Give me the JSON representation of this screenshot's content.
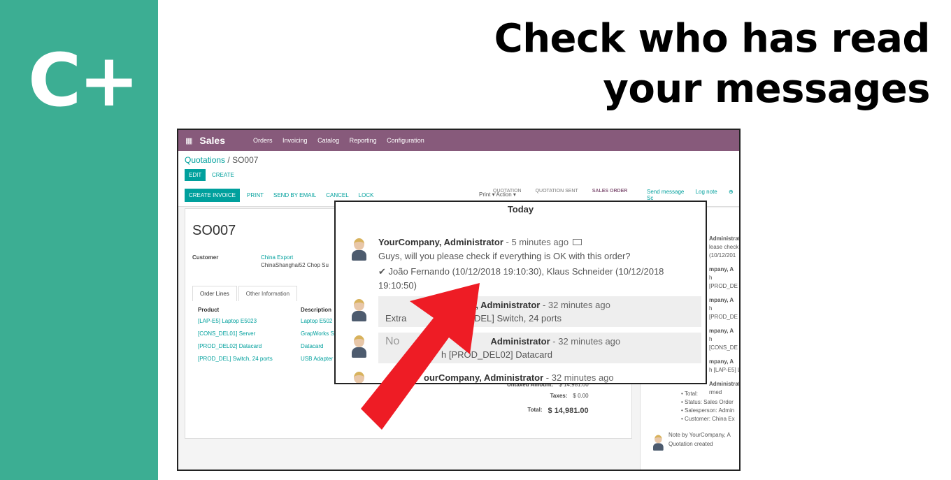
{
  "brand": {
    "logo_text": "C+",
    "side_color": "#3cae93"
  },
  "headline": {
    "line1": "Check who has read",
    "line2": "your messages"
  },
  "app": {
    "name": "Sales",
    "menu": [
      "Orders",
      "Invoicing",
      "Catalog",
      "Reporting",
      "Configuration"
    ],
    "bar_color": "#875a7b"
  },
  "breadcrumb": {
    "parent": "Quotations",
    "sep": " / ",
    "current": "SO007"
  },
  "buttons": {
    "edit": "EDIT",
    "create": "CREATE",
    "print": "Print ▾",
    "action": "Action ▾"
  },
  "actions": [
    "CREATE INVOICE",
    "PRINT",
    "SEND BY EMAIL",
    "CANCEL",
    "LOCK"
  ],
  "status_steps": [
    {
      "label": "QUOTATION",
      "active": false
    },
    {
      "label": "QUOTATION SENT",
      "active": false
    },
    {
      "label": "SALES ORDER",
      "active": true
    }
  ],
  "chatter_tabs": [
    "Send message",
    "Log note",
    "⊕ Sc"
  ],
  "form": {
    "name": "SO007",
    "customer_label": "Customer",
    "customer_value": "China Export",
    "customer_address": "ChinaShanghai52 Chop Su",
    "tabs": [
      "Order Lines",
      "Other Information"
    ],
    "columns": [
      "Product",
      "Description"
    ],
    "lines": [
      {
        "product": "[LAP-E5] Laptop E5023",
        "description": "Laptop E502"
      },
      {
        "product": "[CONS_DEL01] Server",
        "description": "GrapWorks S"
      },
      {
        "product": "[PROD_DEL02] Datacard",
        "description": "Datacard"
      },
      {
        "product": "[PROD_DEL] Switch, 24 ports",
        "description": "USB Adapter"
      }
    ],
    "totals": {
      "untaxed_label": "Untaxed Amount:",
      "untaxed_value": "$ 14,981.00",
      "taxes_label": "Taxes:",
      "taxes_value": "$ 0.00",
      "total_label": "Total:",
      "total_value": "$ 14,981.00"
    }
  },
  "chatter_side": {
    "items": [
      "Administrat",
      "lease check",
      "(10/12/201",
      "mpany, A",
      "h [PROD_DE",
      "mpany, A",
      "h [PROD_DE",
      "mpany, A",
      "h [CONS_DE",
      "mpany, A",
      "h [LAP-E5] L",
      "Administrat",
      "rmed"
    ],
    "bullets": [
      "Total:",
      "Status: Sales Order",
      "Salesperson: Admin",
      "Customer: China Ex"
    ],
    "note_by": "Note by YourCompany, A",
    "note_text": "Quotation created"
  },
  "popup": {
    "date_header": "Today",
    "msg1": {
      "author": "YourCompany, Administrator",
      "ago": " - 5 minutes ago",
      "body": "Guys, will you please check if everything is OK with this order?",
      "read_by": "✔ João Fernando (10/12/2018 19:10:30), Klaus Schneider (10/12/2018 19:10:50)"
    },
    "msg2": {
      "author": "pany, Administrator",
      "ago": " - 32 minutes ago",
      "body": "Extra",
      "body2": "D_DEL] Switch, 24 ports"
    },
    "msg3": {
      "prefix": "No",
      "author": "Administrator",
      "ago": " - 32 minutes ago",
      "body": "h [PROD_DEL02] Datacard"
    },
    "msg4": {
      "author": "ourCompany, Administrator",
      "ago": " - 32 minutes ago"
    }
  },
  "arrow_color": "#ee1c25"
}
